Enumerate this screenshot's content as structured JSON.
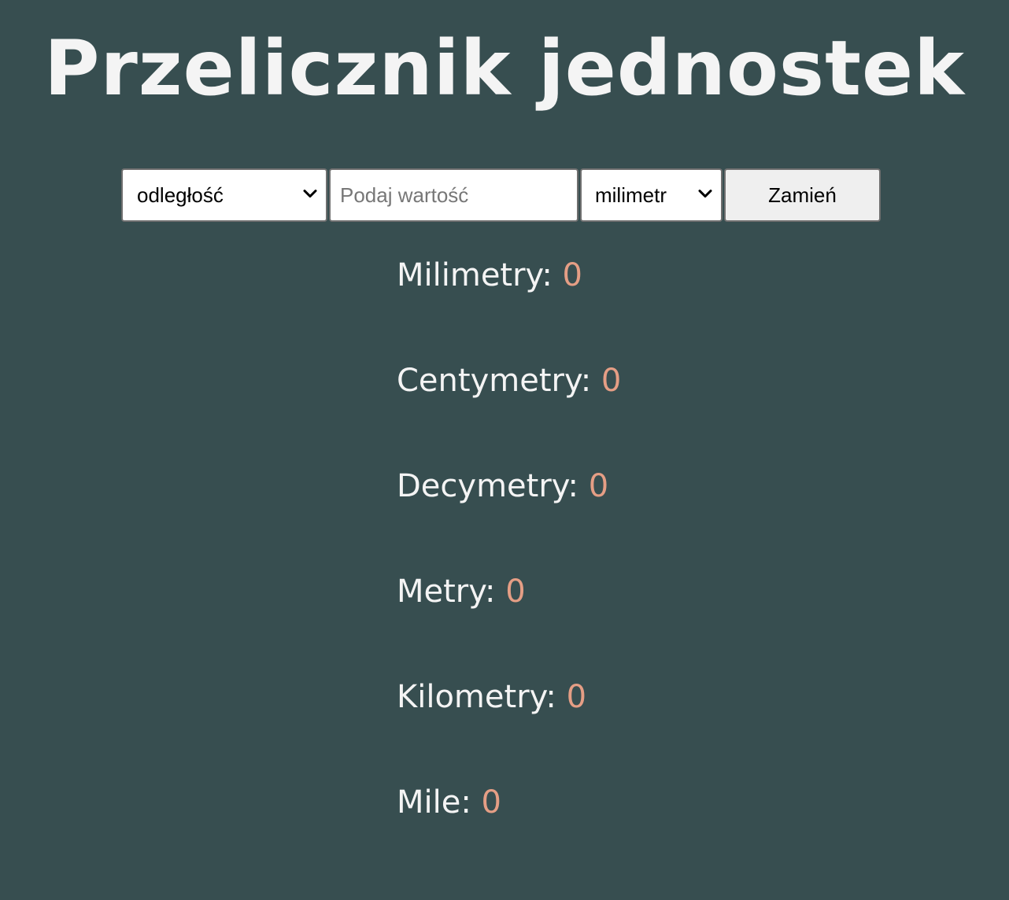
{
  "title": "Przelicznik jednostek",
  "controls": {
    "category_select": {
      "value": "odległość",
      "icon": "chevron-down-icon"
    },
    "value_input": {
      "value": "",
      "placeholder": "Podaj wartość"
    },
    "unit_select": {
      "value": "milimetr",
      "icon": "chevron-down-icon"
    },
    "swap_button": "Zamień"
  },
  "results": [
    {
      "label": "Milimetry:",
      "value": "0"
    },
    {
      "label": "Centymetry:",
      "value": "0"
    },
    {
      "label": "Decymetry:",
      "value": "0"
    },
    {
      "label": "Metry:",
      "value": "0"
    },
    {
      "label": "Kilometry:",
      "value": "0"
    },
    {
      "label": "Mile:",
      "value": "0"
    }
  ],
  "colors": {
    "background": "#374e50",
    "title_text": "#f4f4f4",
    "result_value": "#e59e85"
  }
}
